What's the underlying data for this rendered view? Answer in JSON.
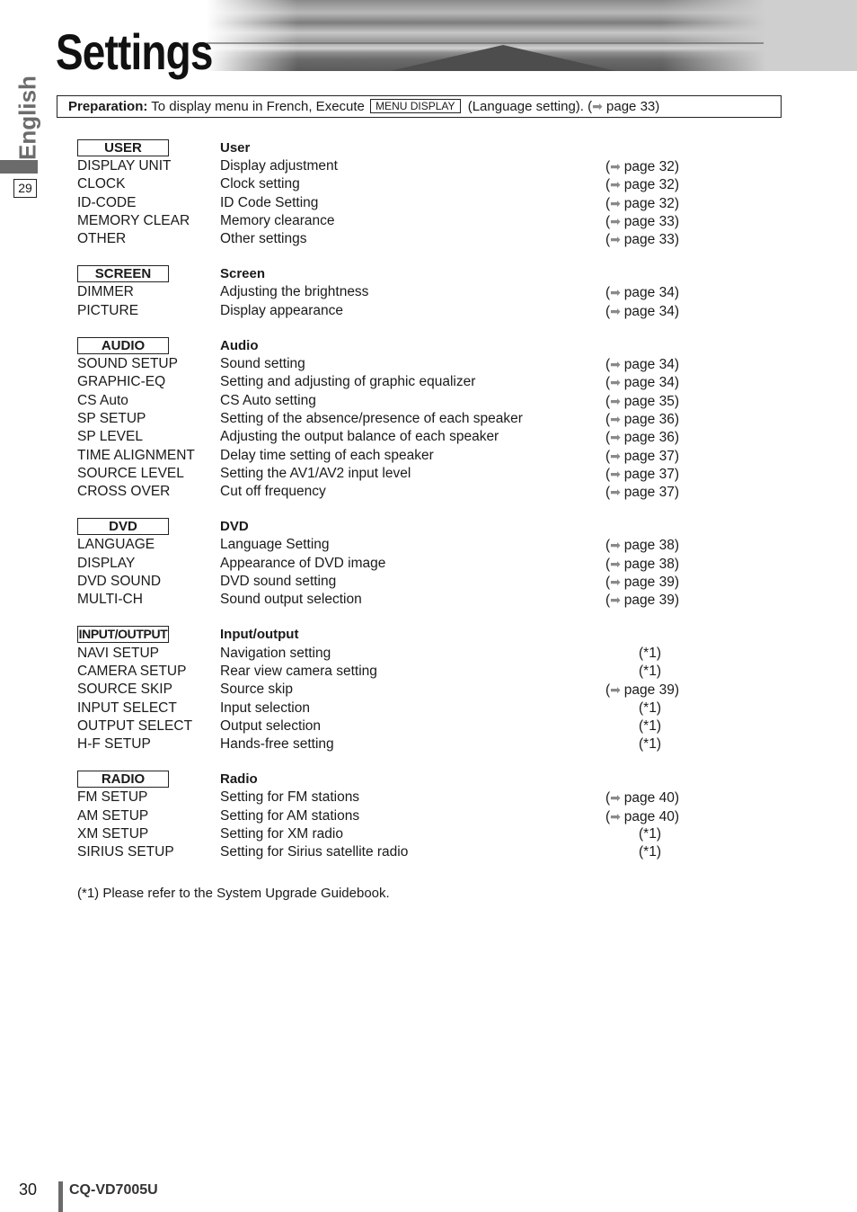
{
  "header": {
    "title": "Settings"
  },
  "side_tab": {
    "language": "English",
    "page_ref": "29"
  },
  "preparation": {
    "label": "Preparation:",
    "text_before": "To display menu in French, Execute",
    "key": "MENU DISPLAY",
    "text_after": "(Language setting). (",
    "arrow_icon": "right-arrow-icon",
    "page_ref": "page 33)"
  },
  "sections": [
    {
      "box_label": "USER",
      "title": "User",
      "items": [
        {
          "key": "DISPLAY UNIT",
          "desc": "Display adjustment",
          "ref": "page 32"
        },
        {
          "key": "CLOCK",
          "desc": "Clock setting",
          "ref": "page 32"
        },
        {
          "key": "ID-CODE",
          "desc": "ID Code Setting",
          "ref": "page 32"
        },
        {
          "key": "MEMORY CLEAR",
          "desc": "Memory clearance",
          "ref": "page 33"
        },
        {
          "key": "OTHER",
          "desc": "Other settings",
          "ref": "page 33"
        }
      ]
    },
    {
      "box_label": "SCREEN",
      "title": "Screen",
      "items": [
        {
          "key": "DIMMER",
          "desc": "Adjusting the brightness",
          "ref": "page 34"
        },
        {
          "key": "PICTURE",
          "desc": "Display appearance",
          "ref": "page 34"
        }
      ]
    },
    {
      "box_label": "AUDIO",
      "title": "Audio",
      "items": [
        {
          "key": "SOUND SETUP",
          "desc": "Sound setting",
          "ref": "page 34"
        },
        {
          "key": "GRAPHIC-EQ",
          "desc": "Setting and adjusting of graphic equalizer",
          "ref": "page 34"
        },
        {
          "key": "CS Auto",
          "desc": "CS Auto setting",
          "ref": "page 35"
        },
        {
          "key": "SP SETUP",
          "desc": "Setting of the absence/presence of each speaker",
          "ref": "page 36"
        },
        {
          "key": "SP LEVEL",
          "desc": "Adjusting the output balance of each speaker",
          "ref": "page 36"
        },
        {
          "key": "TIME ALIGNMENT",
          "desc": "Delay time setting of each speaker",
          "ref": "page 37"
        },
        {
          "key": "SOURCE LEVEL",
          "desc": "Setting the AV1/AV2 input level",
          "ref": "page 37"
        },
        {
          "key": "CROSS OVER",
          "desc": "Cut off frequency",
          "ref": "page 37"
        }
      ]
    },
    {
      "box_label": "DVD",
      "title": "DVD",
      "items": [
        {
          "key": "LANGUAGE",
          "desc": "Language Setting",
          "ref": "page 38"
        },
        {
          "key": "DISPLAY",
          "desc": "Appearance of DVD image",
          "ref": "page 38"
        },
        {
          "key": "DVD SOUND",
          "desc": "DVD sound setting",
          "ref": "page 39"
        },
        {
          "key": "MULTI-CH",
          "desc": "Sound output selection",
          "ref": "page 39"
        }
      ]
    },
    {
      "box_label": "INPUT/OUTPUT",
      "title": "Input/output",
      "items": [
        {
          "key": "NAVI SETUP",
          "desc": "Navigation setting",
          "note": "(*1)"
        },
        {
          "key": "CAMERA SETUP",
          "desc": "Rear view camera setting",
          "note": "(*1)"
        },
        {
          "key": "SOURCE SKIP",
          "desc": "Source skip",
          "ref": "page 39"
        },
        {
          "key": "INPUT SELECT",
          "desc": "Input selection",
          "note": "(*1)"
        },
        {
          "key": "OUTPUT SELECT",
          "desc": "Output selection",
          "note": "(*1)"
        },
        {
          "key": "H-F SETUP",
          "desc": "Hands-free setting",
          "note": "(*1)"
        }
      ]
    },
    {
      "box_label": "RADIO",
      "title": "Radio",
      "items": [
        {
          "key": "FM SETUP",
          "desc": "Setting for FM stations",
          "ref": "page 40"
        },
        {
          "key": "AM SETUP",
          "desc": "Setting for AM stations",
          "ref": "page 40"
        },
        {
          "key": "XM SETUP",
          "desc": "Setting for XM radio",
          "note": "(*1)"
        },
        {
          "key": "SIRIUS SETUP",
          "desc": "Setting for Sirius satellite radio",
          "note": "(*1)"
        }
      ]
    }
  ],
  "footnote": "(*1) Please refer to the System Upgrade Guidebook.",
  "footer": {
    "page_number": "30",
    "model": "CQ-VD7005U"
  },
  "colors": {
    "text": "#1a1a1a",
    "tab_gray": "#6b6b6b",
    "arrow_gray": "#8a8a8a"
  }
}
